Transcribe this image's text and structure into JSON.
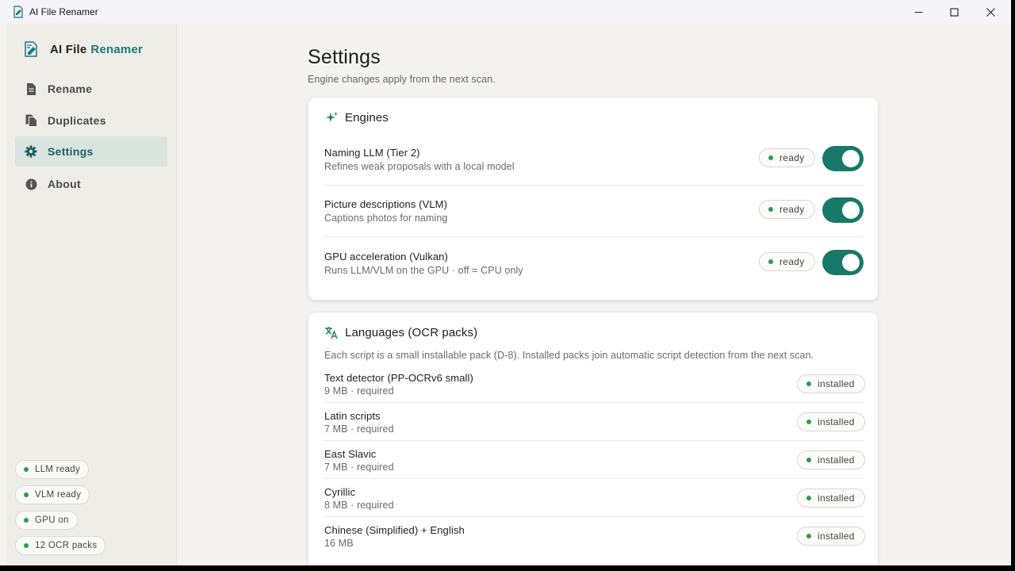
{
  "window": {
    "title": "AI File Renamer",
    "controls": {
      "minimize": "minimize",
      "maximize": "maximize",
      "close": "close"
    }
  },
  "sidebar": {
    "brand_first": "AI File",
    "brand_second": "Renamer",
    "items": [
      {
        "label": "Rename",
        "icon": "document-icon"
      },
      {
        "label": "Duplicates",
        "icon": "copy-icon"
      },
      {
        "label": "Settings",
        "icon": "gear-icon",
        "active": true
      },
      {
        "label": "About",
        "icon": "info-icon"
      }
    ],
    "status": [
      "LLM ready",
      "VLM ready",
      "GPU on",
      "12 OCR packs"
    ]
  },
  "main": {
    "title": "Settings",
    "subtitle": "Engine changes apply from the next scan.",
    "engines": {
      "title": "Engines",
      "rows": [
        {
          "name": "Naming LLM (Tier 2)",
          "desc": "Refines weak proposals with a local model",
          "status": "ready",
          "enabled": true
        },
        {
          "name": "Picture descriptions (VLM)",
          "desc": "Captions photos for naming",
          "status": "ready",
          "enabled": true
        },
        {
          "name": "GPU acceleration (Vulkan)",
          "desc": "Runs LLM/VLM on the GPU · off = CPU only",
          "status": "ready",
          "enabled": true
        }
      ]
    },
    "languages": {
      "title": "Languages (OCR packs)",
      "note": "Each script is a small installable pack (D-8). Installed packs join automatic script detection from the next scan.",
      "packs": [
        {
          "name": "Text detector (PP-OCRv6 small)",
          "desc": "9 MB · required",
          "status": "installed"
        },
        {
          "name": "Latin scripts",
          "desc": "7 MB · required",
          "status": "installed"
        },
        {
          "name": "East Slavic",
          "desc": "7 MB · required",
          "status": "installed"
        },
        {
          "name": "Cyrillic",
          "desc": "8 MB · required",
          "status": "installed"
        },
        {
          "name": "Chinese (Simplified) + English",
          "desc": "16 MB",
          "status": "installed"
        }
      ]
    }
  },
  "colors": {
    "accent": "#18796b",
    "brand": "#1b7d70",
    "status_dot": "#2f9a55"
  }
}
